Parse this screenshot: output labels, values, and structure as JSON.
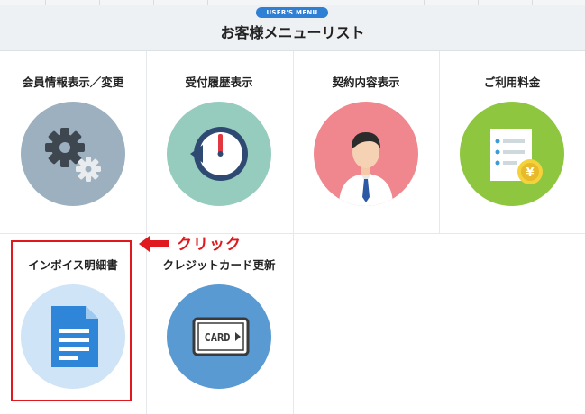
{
  "header": {
    "badge": "USER'S MENU",
    "title": "お客様メニューリスト"
  },
  "menu": {
    "items": [
      {
        "label": "会員情報表示／変更",
        "icon": "gears-icon"
      },
      {
        "label": "受付履歴表示",
        "icon": "clock-history-icon"
      },
      {
        "label": "契約内容表示",
        "icon": "person-icon"
      },
      {
        "label": "ご利用料金",
        "icon": "invoice-yen-icon"
      },
      {
        "label": "インボイス明細書",
        "icon": "document-icon"
      },
      {
        "label": "クレジットカード更新",
        "icon": "credit-card-icon",
        "card_text": "CARD"
      }
    ]
  },
  "annotation": {
    "text": "クリック",
    "color": "#e0191f"
  },
  "colors": {
    "badge": "#2f7fd4",
    "gears_bg": "#9cb0bf",
    "clock_bg": "#95ccbd",
    "person_bg": "#f0878e",
    "fee_bg": "#8ec63f",
    "document_bg": "#cfe4f7",
    "card_bg": "#5a9ad2"
  }
}
